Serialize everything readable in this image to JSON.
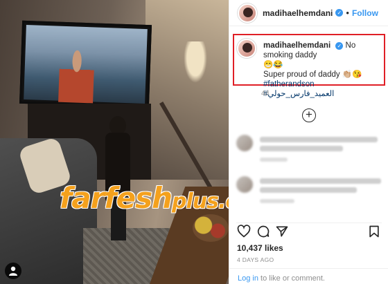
{
  "post": {
    "username": "madihaelhemdani",
    "follow_label": "Follow",
    "separator": "•",
    "verified_glyph": "✓"
  },
  "caption": {
    "username": "madihaelhemdani",
    "line1": "No smoking daddy",
    "emoji1": "😁😂",
    "line2": "Super proud of daddy 👏🏼😘",
    "hashtag1": "#fatherandson",
    "hashtag2": "#العميد_فارس_حولي",
    "time_ago": "4d"
  },
  "add_comment_icon": "plus-circle-icon",
  "engagement": {
    "likes": "10,437 likes",
    "date": "4 DAYS AGO"
  },
  "footer": {
    "login_link": "Log in",
    "rest": " to like or comment."
  },
  "watermark": {
    "main": "farfesh",
    "suffix": "plus.com"
  },
  "colors": {
    "accent": "#3897f0",
    "highlight_border": "#e01f26",
    "watermark": "#f4a11d"
  }
}
